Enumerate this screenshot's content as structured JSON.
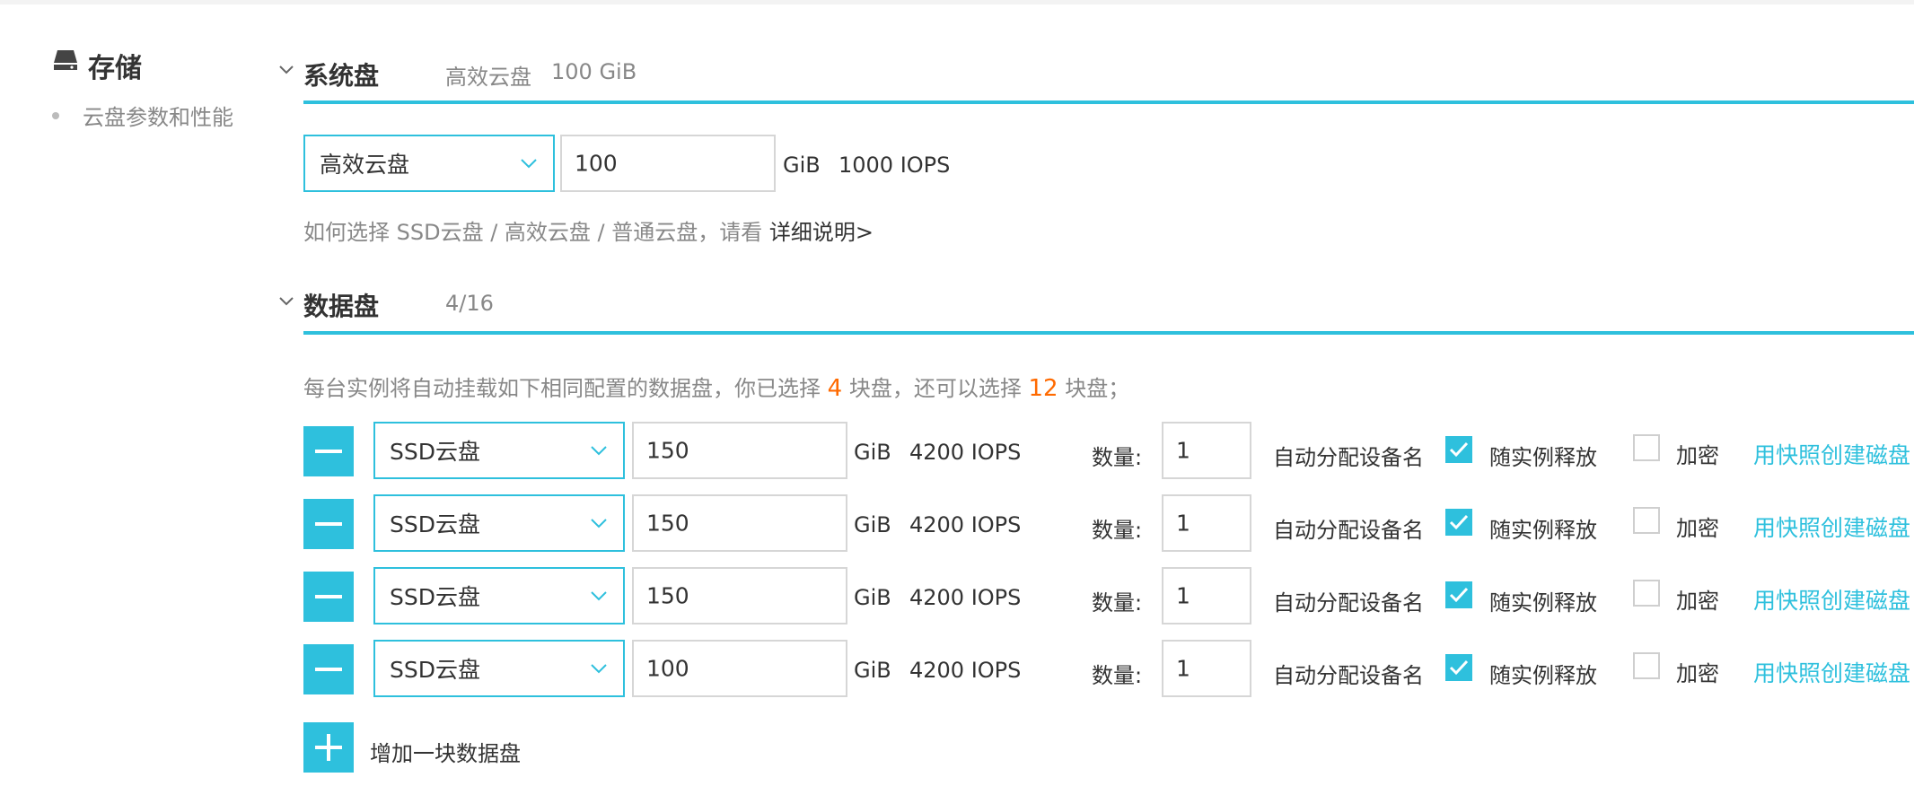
{
  "sidebar": {
    "title": "存储",
    "items": [
      {
        "label": "云盘参数和性能"
      }
    ]
  },
  "system_disk": {
    "title": "系统盘",
    "summary_type": "高效云盘",
    "summary_size": "100 GiB",
    "type_value": "高效云盘",
    "size_value": "100",
    "unit": "GiB",
    "iops": "1000 IOPS",
    "help_text": "如何选择 SSD云盘 / 高效云盘 / 普通云盘，请看",
    "help_link": "详细说明>"
  },
  "data_disk": {
    "title": "数据盘",
    "count_summary": "4/16",
    "note_prefix": "每台实例将自动挂载如下相同配置的数据盘，你已选择",
    "selected_count": "4",
    "note_mid": "块盘，还可以选择",
    "remaining_count": "12",
    "note_suffix": "块盘；",
    "quantity_label": "数量:",
    "device_label": "自动分配设备名",
    "release_label": "随实例释放",
    "encrypt_label": "加密",
    "snapshot_link": "用快照创建磁盘",
    "rows": [
      {
        "type": "SSD云盘",
        "size": "150",
        "unit": "GiB",
        "iops": "4200 IOPS",
        "quantity": "1",
        "release_checked": true,
        "encrypt_checked": false
      },
      {
        "type": "SSD云盘",
        "size": "150",
        "unit": "GiB",
        "iops": "4200 IOPS",
        "quantity": "1",
        "release_checked": true,
        "encrypt_checked": false
      },
      {
        "type": "SSD云盘",
        "size": "150",
        "unit": "GiB",
        "iops": "4200 IOPS",
        "quantity": "1",
        "release_checked": true,
        "encrypt_checked": false
      },
      {
        "type": "SSD云盘",
        "size": "100",
        "unit": "GiB",
        "iops": "4200 IOPS",
        "quantity": "1",
        "release_checked": true,
        "encrypt_checked": false
      }
    ],
    "add_label": "增加一块数据盘"
  },
  "colors": {
    "accent": "#2ec0dd",
    "highlight": "#ff6a00"
  }
}
